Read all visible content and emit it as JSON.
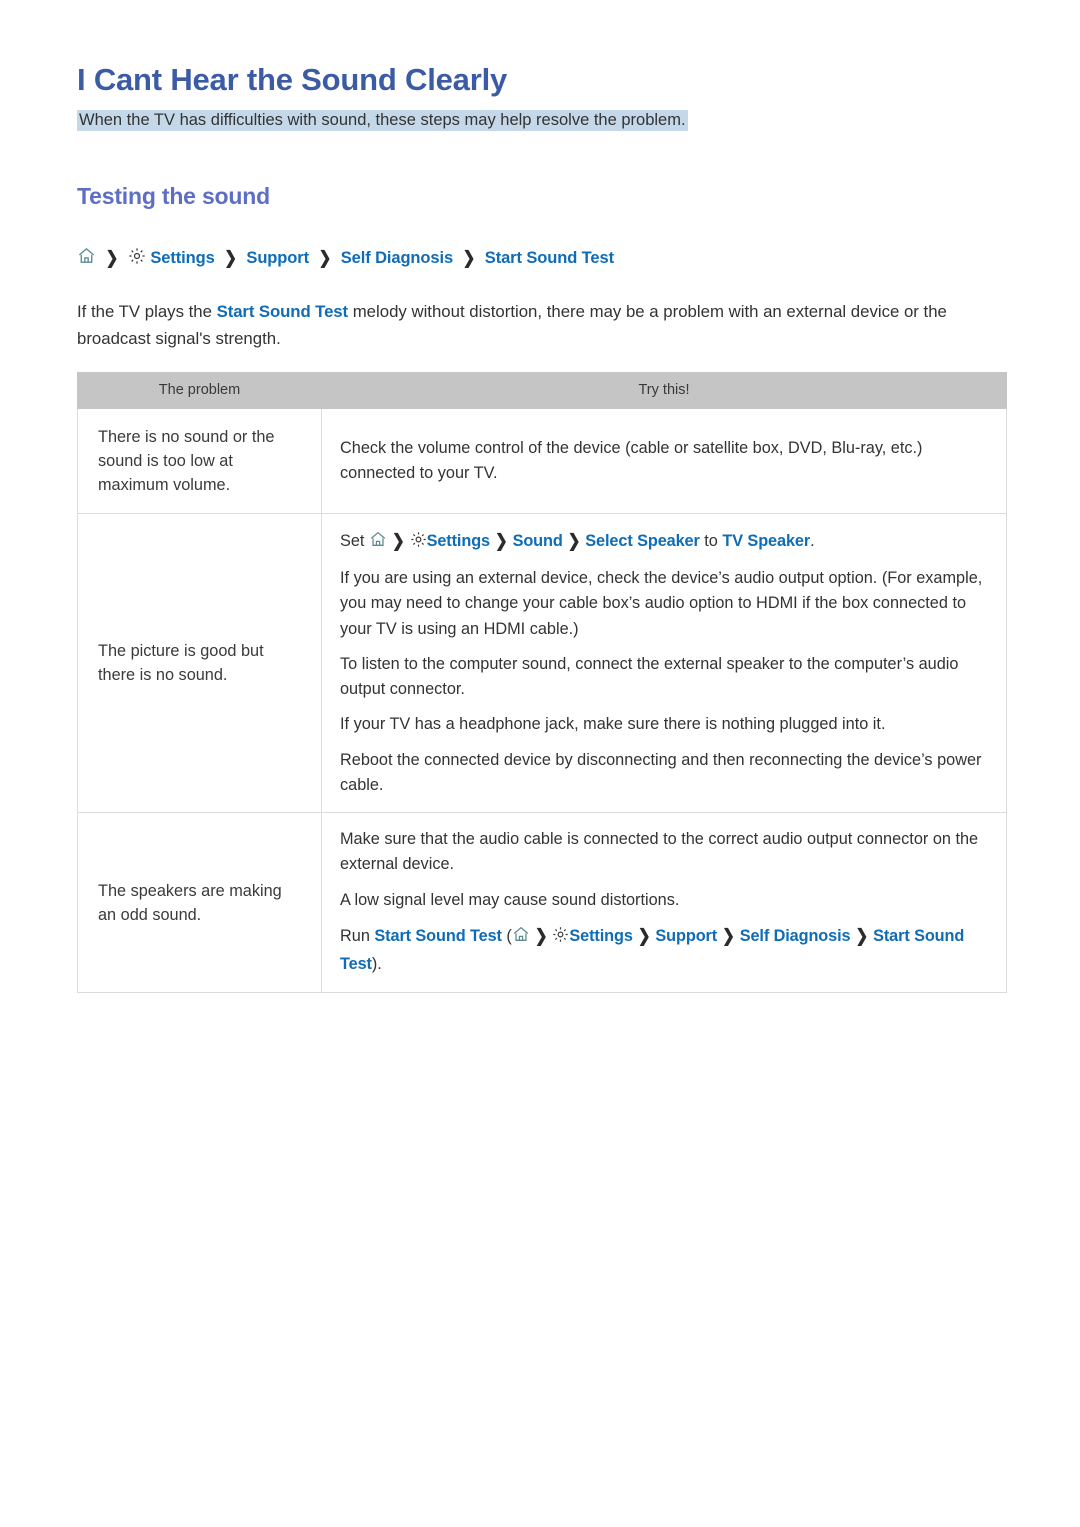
{
  "header": {
    "title": "I Cant Hear the Sound Clearly",
    "subtitle": "When the TV has difficulties with sound, these steps may help resolve the problem.",
    "highlight_color": "#c4d8e9",
    "title_color": "#3b5ba5"
  },
  "section": {
    "title": "Testing the sound",
    "title_color": "#5f6ec5"
  },
  "breadcrumb": {
    "home_icon": "home-icon",
    "gear_icon": "gear-icon",
    "separator": "❯",
    "items": [
      "Settings",
      "Support",
      "Self Diagnosis",
      "Start Sound Test"
    ]
  },
  "intro": {
    "before": "If the TV plays the ",
    "link": "Start Sound Test",
    "after": " melody without distortion, there may be a problem with an external device or the broadcast signal's strength."
  },
  "table": {
    "headers": [
      "The problem",
      "Try this!"
    ],
    "header_bg": "#c5c5c5",
    "link_color": "#0f6cb5",
    "rows": [
      {
        "problem": "There is no sound or the sound is too low at maximum volume.",
        "paragraphs": [
          "Check the volume control of the device (cable or satellite box, DVD, Blu-ray, etc.) connected to your TV."
        ]
      },
      {
        "problem": "The picture is good but there is no sound.",
        "path": {
          "prefix": "Set",
          "items": [
            "Settings",
            "Sound",
            "Select Speaker"
          ],
          "mid": "to",
          "target": "TV Speaker",
          "suffix": "."
        },
        "paragraphs": [
          "If you are using an external device, check the device’s audio output option. (For example, you may need to change your cable box’s audio option to HDMI if the box connected to your TV is using an HDMI cable.)",
          "To listen to the computer sound, connect the external speaker to the computer’s audio output connector.",
          "If your TV has a headphone jack, make sure there is nothing plugged into it.",
          "Reboot the connected device by disconnecting and then reconnecting the device’s power cable."
        ]
      },
      {
        "problem": "The speakers are making an odd sound.",
        "paragraphs": [
          "Make sure that the audio cable is connected to the correct audio output connector on the external device.",
          "A low signal level may cause sound distortions."
        ],
        "run_path": {
          "prefix": "Run",
          "name": "Start Sound Test",
          "open_paren": "(",
          "items": [
            "Settings",
            "Support",
            "Self Diagnosis",
            "Start Sound Test"
          ],
          "close_paren": ")."
        }
      }
    ]
  }
}
